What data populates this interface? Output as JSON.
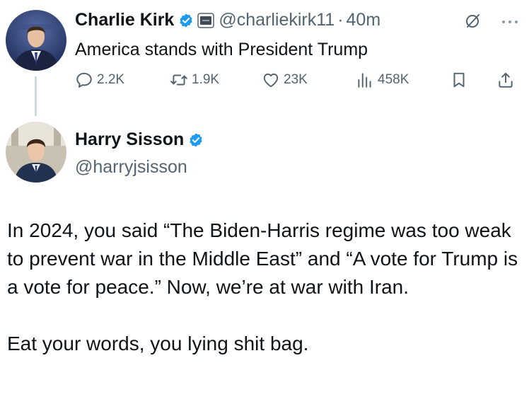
{
  "original_tweet": {
    "author_name": "Charlie Kirk",
    "handle": "@charliekirk11",
    "separator": "·",
    "time": "40m",
    "text": "America stands with President Trump",
    "stats": {
      "replies": "2.2K",
      "reposts": "1.9K",
      "likes": "23K",
      "views": "458K"
    }
  },
  "reply_tweet": {
    "author_name": "Harry Sisson",
    "handle": "@harryjsisson",
    "paragraphs": [
      "In 2024, you said “The Biden-Harris regime was too weak to prevent war in the Middle East” and “A vote for Trump is a vote for peace.” Now, we’re at war with Iran.",
      "Eat your words, you lying shit bag."
    ]
  },
  "icons": {
    "verified": "verified-badge-icon",
    "affiliate": "affiliate-org-icon",
    "grok": "grok-icon",
    "more": "more-icon",
    "reply": "reply-icon",
    "retweet": "retweet-icon",
    "like": "heart-icon",
    "views": "views-icon",
    "bookmark": "bookmark-icon",
    "share": "share-icon"
  },
  "colors": {
    "verified_blue": "#1d9bf0",
    "text_primary": "#0f1419",
    "text_secondary": "#536471",
    "thread_line": "#cfd9de"
  }
}
